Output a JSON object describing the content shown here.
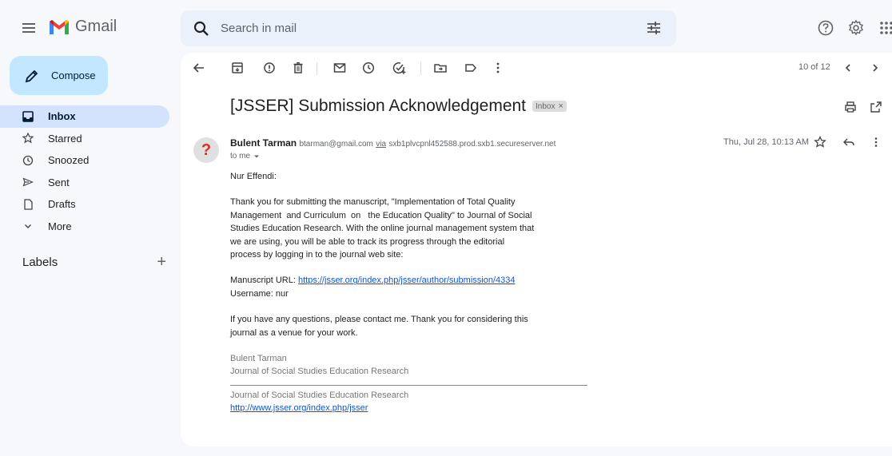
{
  "app": {
    "name": "Gmail"
  },
  "search": {
    "placeholder": "Search in mail"
  },
  "compose": {
    "label": "Compose"
  },
  "nav": {
    "items": [
      {
        "label": "Inbox",
        "icon": "inbox-icon",
        "active": true
      },
      {
        "label": "Starred",
        "icon": "star-icon"
      },
      {
        "label": "Snoozed",
        "icon": "clock-icon"
      },
      {
        "label": "Sent",
        "icon": "send-icon"
      },
      {
        "label": "Drafts",
        "icon": "draft-icon"
      },
      {
        "label": "More",
        "icon": "chevron-down-icon"
      }
    ]
  },
  "labels": {
    "title": "Labels",
    "add": "+"
  },
  "pager": {
    "text": "10 of 12"
  },
  "email": {
    "subject": "[JSSER] Submission Acknowledgement",
    "chip": {
      "label": "Inbox",
      "close": "×"
    },
    "sender_name": "Bulent Tarman",
    "sender_email": "btarman@gmail.com",
    "via_label": "via",
    "via_host": "sxb1plvcpnl452588.prod.sxb1.secureserver.net",
    "to_me": "to me",
    "date": "Thu, Jul 28, 10:13 AM",
    "avatar_glyph": "?",
    "greeting": "Nur Effendi:",
    "para1": [
      "Thank you for submitting the manuscript, \"Implementation of Total Quality",
      "Management  and Curriculum  on   the Education Quality\" to Journal of Social",
      "Studies Education Research. With the online journal management system that",
      "we are using, you will be able to track its progress through the editorial",
      "process by logging in to the journal web site:"
    ],
    "manuscript_label": "Manuscript URL: ",
    "manuscript_url": "https://jsser.org/index.php/jsser/author/submission/4334",
    "username_line": "Username: nur",
    "para2": [
      "If you have any questions, please contact me. Thank you for considering this",
      "journal as a venue for your work."
    ],
    "signature": {
      "name": "Bulent Tarman",
      "org": "Journal of Social Studies Education Research",
      "footer_org": "Journal of Social Studies Education Research",
      "footer_url": "http://www.jsser.org/index.php/jsser"
    }
  },
  "colors": {
    "background": "#f6f8fc",
    "compose": "#c2e7ff",
    "active_nav": "#d3e3fd",
    "search": "#eaf1fb",
    "link": "#1155cc"
  }
}
